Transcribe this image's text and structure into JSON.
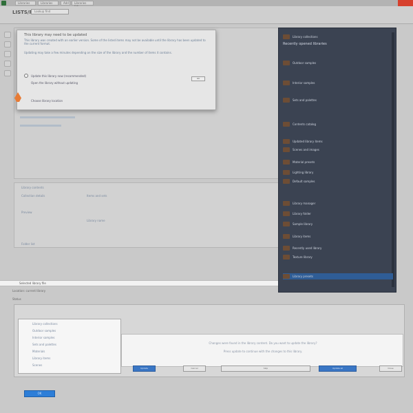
{
  "window": {
    "tabs": [
      "Libraries",
      "Libraries",
      "Add",
      "Libraries list"
    ],
    "colors": {
      "close": "#d6402d",
      "accent": "#2d7ed8",
      "panel": "#3b4352"
    }
  },
  "menubar": {
    "app_name": "LISTS/RIT",
    "search_text": "Lookup find"
  },
  "info_dialog": {
    "heading": "This library may need to be updated",
    "para1": "This library was created with an earlier version. Some of the listed items may not be available until the library has been updated to the current format.",
    "para2": "Updating may take a few minutes depending on the size of the library and the number of items it contains.",
    "option1": "Update this library now (recommended)",
    "option2": "Open the library without updating",
    "option3": "Choose library location",
    "ok_label": "OK"
  },
  "mid_panel": {
    "rows": [
      "Library contents",
      "Collection details",
      "Items and sets",
      "Preview",
      "Library name",
      "Folder list"
    ]
  },
  "right_panel": {
    "title": "Recently opened libraries",
    "rows": [
      "Library collections",
      "Outdoor samples",
      "Interior samples",
      "Sets and palettes",
      "Contents catalog",
      "Updated library items",
      "Scenes and images",
      "Material presets",
      "Lighting library",
      "Default samples",
      "Library manager",
      "Library folder",
      "Sample library",
      "Library items",
      "Recently used library",
      "Texture library",
      "Library presets"
    ],
    "selected_row": "Library presets"
  },
  "select_strip": {
    "label": "Selected library file"
  },
  "lower_labels": {
    "line1": "Location: current library",
    "line2": "Status"
  },
  "bottom_dialog": {
    "list_items": [
      "Library collections",
      "Outdoor samples",
      "Interior samples",
      "Sets and palettes",
      "Materials",
      "Library items",
      "Scenes"
    ],
    "message1": "Changes were found in the library content. Do you want to update the library?",
    "message2": "Press update to continue with the changes to this library.",
    "btn_primary": "Update",
    "btn_cancel": "Cancel",
    "btn_skip": "Skip",
    "btn_update_all": "Update all",
    "btn_close": "Close"
  },
  "footer": {
    "button_label": "OK"
  }
}
